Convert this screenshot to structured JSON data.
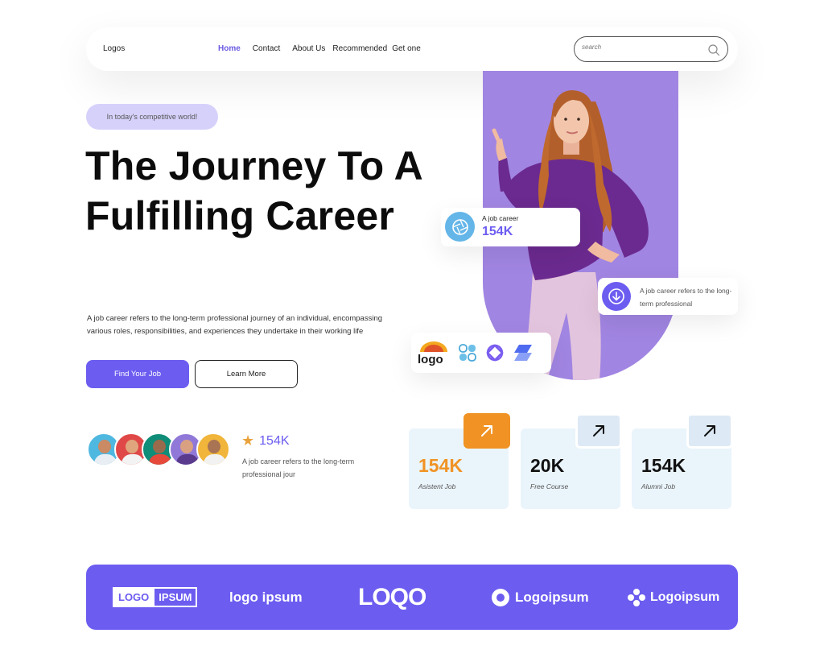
{
  "nav": {
    "logo": "Logos",
    "links": [
      "Home",
      "Contact",
      "About Us",
      "Recommended",
      "Get one"
    ],
    "active": "Home",
    "search_placeholder": "search"
  },
  "hero": {
    "pill": "In today's competitive world!",
    "title": "The Journey To A Fulfilling Career",
    "description": "A job career refers to the long-term professional journey of an individual, encompassing various roles, responsibilities, and experiences they undertake in their working life",
    "primary_button": "Find Your Job",
    "secondary_button": "Learn More"
  },
  "social_proof": {
    "rating_value": "154K",
    "text": "A job career refers to the long-term professional jour"
  },
  "floating": {
    "card1_label": "A job career",
    "card1_value": "154K",
    "card2_text": "A job career refers to the long-term professional",
    "partner_logo_text": "logo"
  },
  "stats": [
    {
      "value": "154K",
      "label": "Asistent Job"
    },
    {
      "value": "20K",
      "label": "Free Course"
    },
    {
      "value": "154K",
      "label": "Alumni Job"
    }
  ],
  "logos": {
    "logo1a": "LOGO",
    "logo1b": "IPSUM",
    "logo2": "logo ipsum",
    "logo3": "LOQO",
    "logo4": "Logoipsum",
    "logo5": "Logoipsum"
  },
  "colors": {
    "accent": "#6c5df0",
    "orange": "#f09324",
    "pill": "#d6d1fb",
    "stat_bg": "#eaf4fb"
  }
}
